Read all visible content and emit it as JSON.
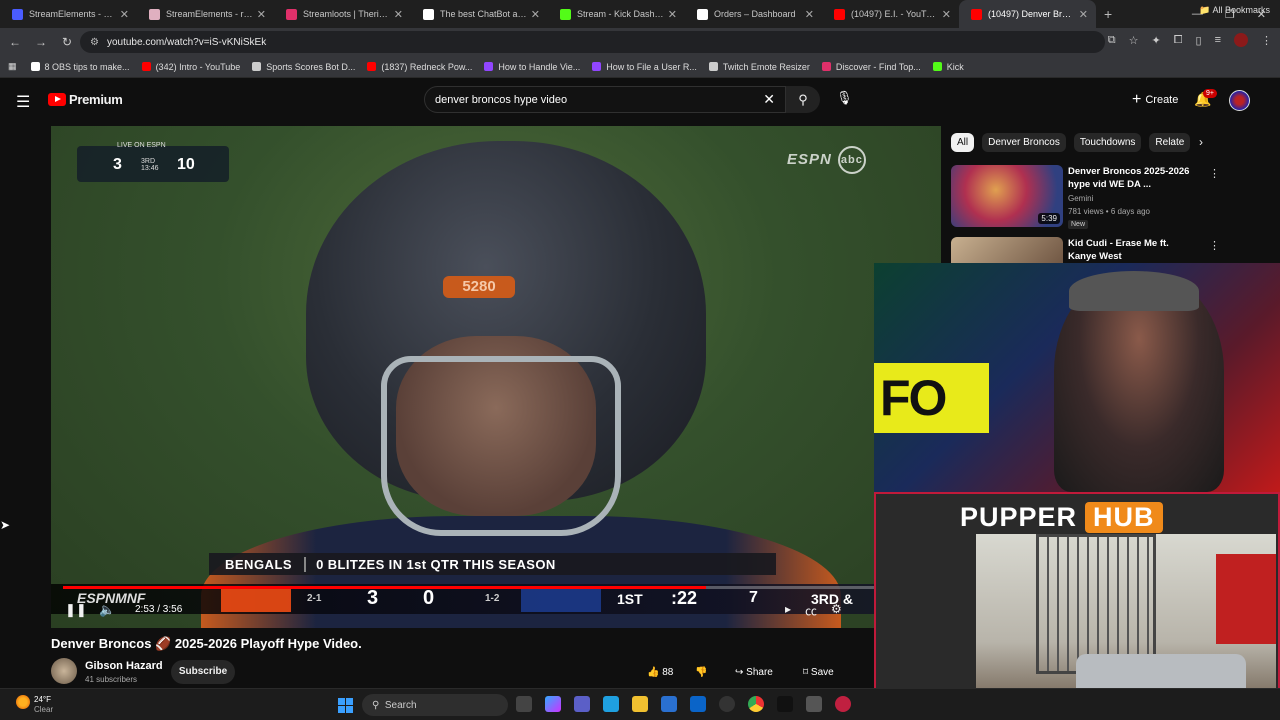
{
  "browser": {
    "tabs": [
      {
        "title": "StreamElements - Overlay",
        "color": "#4a5cff"
      },
      {
        "title": "StreamElements - ripped",
        "color": "#e0b0c0"
      },
      {
        "title": "Streamloots | Therippedr",
        "color": "#e0306a"
      },
      {
        "title": "The best ChatBot and W",
        "color": "#ffffff"
      },
      {
        "title": "Stream - Kick Dashboard",
        "color": "#53fc18"
      },
      {
        "title": "Orders – Dashboard",
        "color": "#ffffff"
      },
      {
        "title": "(10497) E.I. - YouTube",
        "color": "#ff0000"
      },
      {
        "title": "(10497) Denver Bronc",
        "color": "#ff0000",
        "active": true
      }
    ],
    "url": "youtube.com/watch?v=iS-vKNiSkEk",
    "bookmarks": [
      {
        "label": "8 OBS tips to make...",
        "color": "#ffffff"
      },
      {
        "label": "(342) Intro - YouTube",
        "color": "#ff0000"
      },
      {
        "label": "Sports Scores Bot D...",
        "color": "#cccccc"
      },
      {
        "label": "(1837) Redneck Pow...",
        "color": "#ff0000"
      },
      {
        "label": "How to Handle Vie...",
        "color": "#9146ff"
      },
      {
        "label": "How to File a User R...",
        "color": "#9146ff"
      },
      {
        "label": "Twitch Emote Resizer",
        "color": "#cccccc"
      },
      {
        "label": "Discover - Find Top...",
        "color": "#e0306a"
      },
      {
        "label": "Kick",
        "color": "#53fc18"
      }
    ],
    "all_bookmarks": "All Bookmarks"
  },
  "yt": {
    "logo_text": "Premium",
    "search_value": "denver broncos hype video",
    "create_label": "Create",
    "notif_count": "9+"
  },
  "video": {
    "live_label": "LIVE ON ESPN",
    "top_score_away": "3",
    "top_quarter": "3RD",
    "top_clock": "13:46",
    "top_score_home": "10",
    "network": "ESPN",
    "network2": "abc",
    "helmet_number": "5280",
    "chyron_team": "BENGALS",
    "chyron_msg": "0 BLITZES IN 1st QTR THIS SEASON",
    "bug_brand": "ESPNMNF",
    "bug_rec1": "2-1",
    "bug_score1": "3",
    "bug_score2": "0",
    "bug_rec2": "1-2",
    "bug_quarter": "1ST",
    "bug_clock": ":22",
    "bug_play": "7",
    "bug_down": "3RD &",
    "time_display": "2:53 / 3:56",
    "progress_fraction": 0.743,
    "title": "Denver Broncos 🏈 2025-2026 Playoff Hype Video.",
    "channel": "Gibson Hazard",
    "subs": "41 subscribers",
    "subscribe": "Subscribe",
    "likes": "88",
    "share": "Share",
    "save": "Save"
  },
  "sidebar": {
    "chips": [
      "All",
      "Denver Broncos",
      "Touchdowns",
      "Relate"
    ],
    "recs": [
      {
        "title": "Denver Broncos 2025-2026 hype vid WE DA ...",
        "channel": "Gemini",
        "meta": "781 views • 6 days ago",
        "badge": "New",
        "duration": "5:39"
      },
      {
        "title": "Kid Cudi - Erase Me ft. Kanye West",
        "channel": "",
        "meta": "",
        "badge": "",
        "duration": ""
      }
    ]
  },
  "overlay": {
    "cam1_sign": "FO",
    "brand_a": "PUPPER",
    "brand_b": "HUB"
  },
  "taskbar": {
    "temp": "24°F",
    "cond": "Clear",
    "search": "Search"
  }
}
